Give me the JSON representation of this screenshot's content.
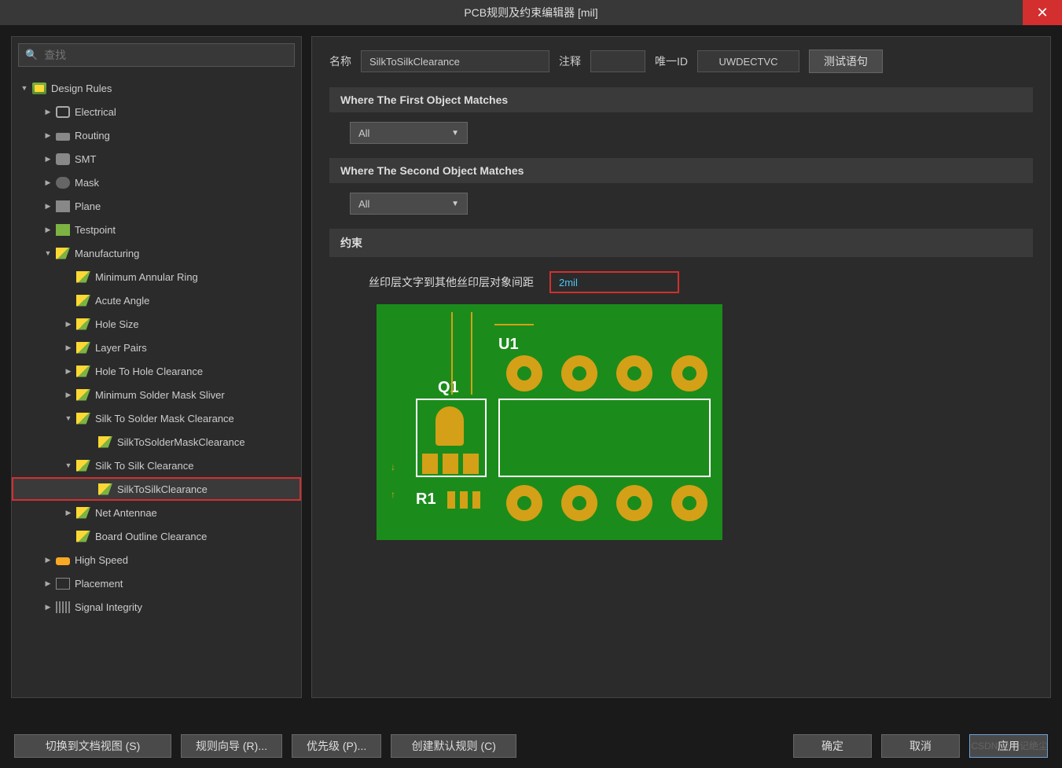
{
  "title": "PCB规则及约束编辑器 [mil]",
  "search": {
    "placeholder": "查找"
  },
  "tree": {
    "root": "Design Rules",
    "electrical": "Electrical",
    "routing": "Routing",
    "smt": "SMT",
    "mask": "Mask",
    "plane": "Plane",
    "testpoint": "Testpoint",
    "manufacturing": "Manufacturing",
    "min_annular": "Minimum Annular Ring",
    "acute_angle": "Acute Angle",
    "hole_size": "Hole Size",
    "layer_pairs": "Layer Pairs",
    "hole_to_hole": "Hole To Hole Clearance",
    "min_solder_mask": "Minimum Solder Mask Sliver",
    "silk_solder_cat": "Silk To Solder Mask Clearance",
    "silk_solder_rule": "SilkToSolderMaskClearance",
    "silk_silk_cat": "Silk To Silk Clearance",
    "silk_silk_rule": "SilkToSilkClearance",
    "net_antennae": "Net Antennae",
    "board_outline": "Board Outline Clearance",
    "high_speed": "High Speed",
    "placement": "Placement",
    "signal_integrity": "Signal Integrity"
  },
  "form": {
    "name_label": "名称",
    "name_value": "SilkToSilkClearance",
    "comment_label": "注释",
    "comment_value": "",
    "uid_label": "唯一ID",
    "uid_value": "UWDECTVC",
    "test_btn": "测试语句"
  },
  "sections": {
    "first_match": "Where The First Object Matches",
    "second_match": "Where The Second Object Matches",
    "constraints": "约束",
    "all": "All"
  },
  "constraint": {
    "label": "丝印层文字到其他丝印层对象间距",
    "value": "2mil"
  },
  "preview": {
    "u1": "U1",
    "q1": "Q1",
    "r1": "R1"
  },
  "footer": {
    "switch_view": "切换到文档视图 (S)",
    "wizard": "规则向导 (R)...",
    "priority": "优先级 (P)...",
    "create_default": "创建默认规则 (C)",
    "ok": "确定",
    "cancel": "取消",
    "apply": "应用"
  },
  "watermark": "CSDN @一记绝尘"
}
